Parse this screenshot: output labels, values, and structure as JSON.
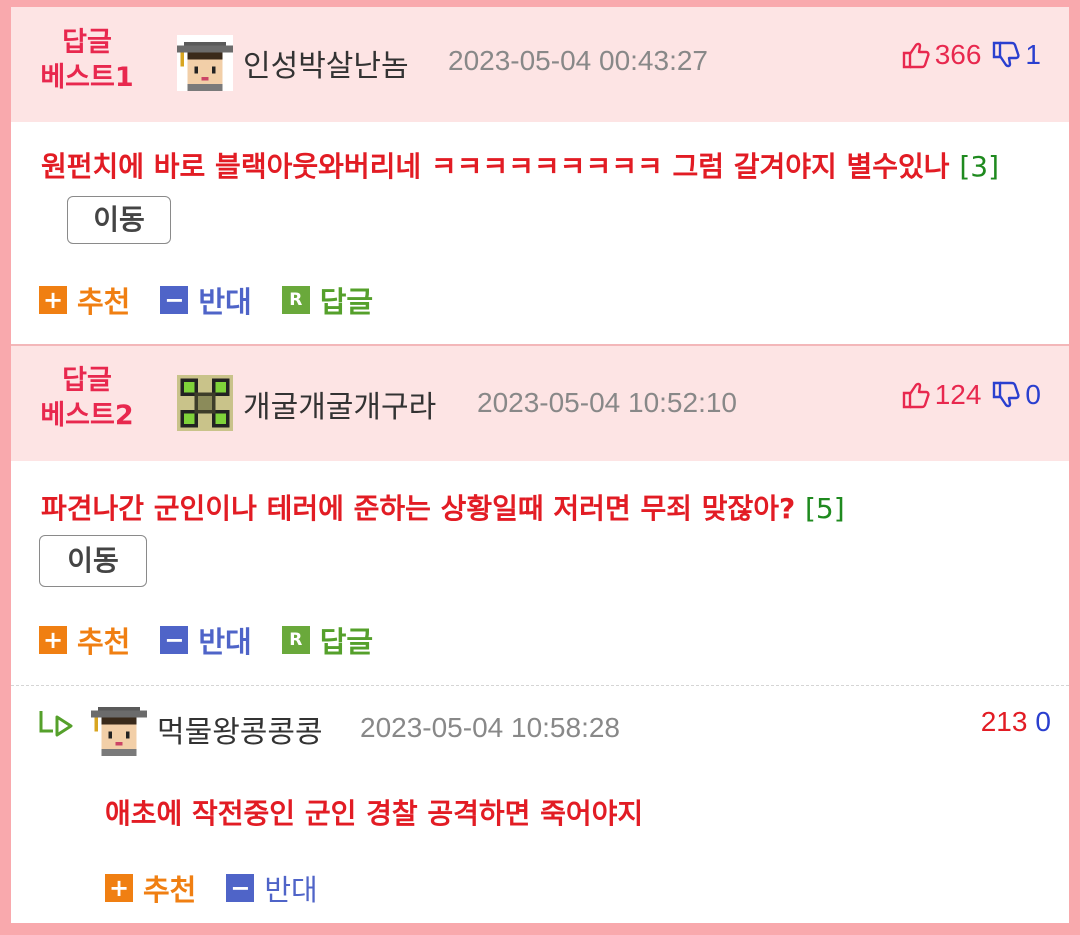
{
  "comments": [
    {
      "best_label_line1": "답글",
      "best_label_line2": "베스트1",
      "avatar": "graduate-avatar-icon",
      "username": "인성박살난놈",
      "timestamp": "2023-05-04 00:43:27",
      "upvotes": "366",
      "downvotes": "1",
      "text": "원펀치에 바로 블랙아웃와버리네 ㅋㅋㅋㅋㅋㅋㅋㅋㅋ 그럼 갈겨야지 별수있나",
      "reply_count": "[3]",
      "move_label": "이동",
      "actions": {
        "recommend": "추천",
        "oppose": "반대",
        "reply": "답글"
      }
    },
    {
      "best_label_line1": "답글",
      "best_label_line2": "베스트2",
      "avatar": "drone-avatar-icon",
      "username": "개굴개굴개구라",
      "timestamp": "2023-05-04 10:52:10",
      "upvotes": "124",
      "downvotes": "0",
      "text": "파견나간 군인이나 테러에 준하는 상황일때 저러면 무죄 맞잖아?",
      "reply_count": "[5]",
      "move_label": "이동",
      "actions": {
        "recommend": "추천",
        "oppose": "반대",
        "reply": "답글"
      }
    }
  ],
  "reply": {
    "avatar": "graduate-avatar-icon",
    "username": "먹물왕콩콩콩",
    "timestamp": "2023-05-04 10:58:28",
    "upvotes": "213",
    "downvotes": "0",
    "text": "애초에 작전중인 군인 경찰 공격하면 죽어야지",
    "actions": {
      "recommend": "추천",
      "oppose": "반대"
    }
  },
  "icons": {
    "plus": "+",
    "minus": "−",
    "reply_box": "R"
  },
  "colors": {
    "background": "#f9a9ad",
    "header_bg": "#fde4e4",
    "accent_red": "#e21c24",
    "best_label": "#e8284e",
    "recommend": "#f07f12",
    "oppose": "#4f64c8",
    "reply_green": "#6aa93b"
  }
}
